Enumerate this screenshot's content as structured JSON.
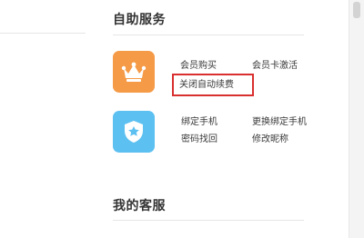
{
  "self_service": {
    "title": "自助服务",
    "member_group": {
      "icon": "crown-icon",
      "icon_bg": "#f59a47",
      "links": [
        "会员购买",
        "会员卡激活",
        "关闭自动续费"
      ]
    },
    "security_group": {
      "icon": "shield-star-icon",
      "icon_bg": "#5cc0f1",
      "links": [
        "绑定手机",
        "更换绑定手机",
        "密码找回",
        "修改昵称"
      ]
    },
    "highlight_color": "#d92f2f"
  },
  "my_service": {
    "title": "我的客服"
  }
}
